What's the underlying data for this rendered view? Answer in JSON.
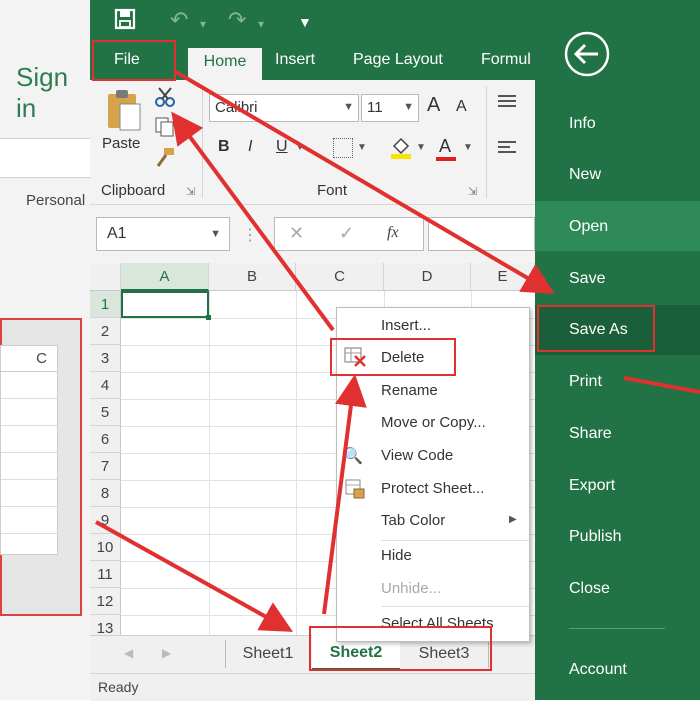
{
  "colors": {
    "excel_green": "#217346",
    "annotation_red": "#e03030",
    "backstage_highlight": "#2f8a59"
  },
  "background_window": {
    "title": "Sign in",
    "tab": "Personal",
    "table_header": "C"
  },
  "qat": {
    "save_icon": "save-icon",
    "undo_icon": "undo-icon",
    "redo_icon": "redo-icon",
    "customize_icon": "customize-icon"
  },
  "tabs": {
    "file": "File",
    "home": "Home",
    "insert": "Insert",
    "page_layout": "Page Layout",
    "formulas": "Formul"
  },
  "ribbon": {
    "paste": "Paste",
    "clipboard_group": "Clipboard",
    "font_group": "Font",
    "font_name": "Calibri",
    "font_size": "11",
    "bold": "B",
    "italic": "I",
    "underline": "U",
    "font_color_letter": "A",
    "grow_font": "A",
    "shrink_font": "A"
  },
  "formula_bar": {
    "name_box": "A1",
    "fx": "fx"
  },
  "grid": {
    "columns": [
      "A",
      "B",
      "C",
      "D",
      "E"
    ],
    "rows": [
      "1",
      "2",
      "3",
      "4",
      "5",
      "6",
      "7",
      "8",
      "9",
      "10",
      "11",
      "12",
      "13"
    ],
    "selected_cell": "A1"
  },
  "context_menu": {
    "items": [
      "Insert...",
      "Delete",
      "Rename",
      "Move or Copy...",
      "View Code",
      "Protect Sheet...",
      "Tab Color",
      "Hide",
      "Unhide...",
      "Select All Sheets"
    ]
  },
  "sheet_tabs": [
    "Sheet1",
    "Sheet2",
    "Sheet3"
  ],
  "active_sheet": "Sheet2",
  "status": "Ready",
  "backstage": {
    "back_icon": "back-arrow-icon",
    "items": [
      "Info",
      "New",
      "Open",
      "Save",
      "Save As",
      "Print",
      "Share",
      "Export",
      "Publish",
      "Close",
      "Account"
    ],
    "highlighted": "Open",
    "selected": "Save As"
  }
}
